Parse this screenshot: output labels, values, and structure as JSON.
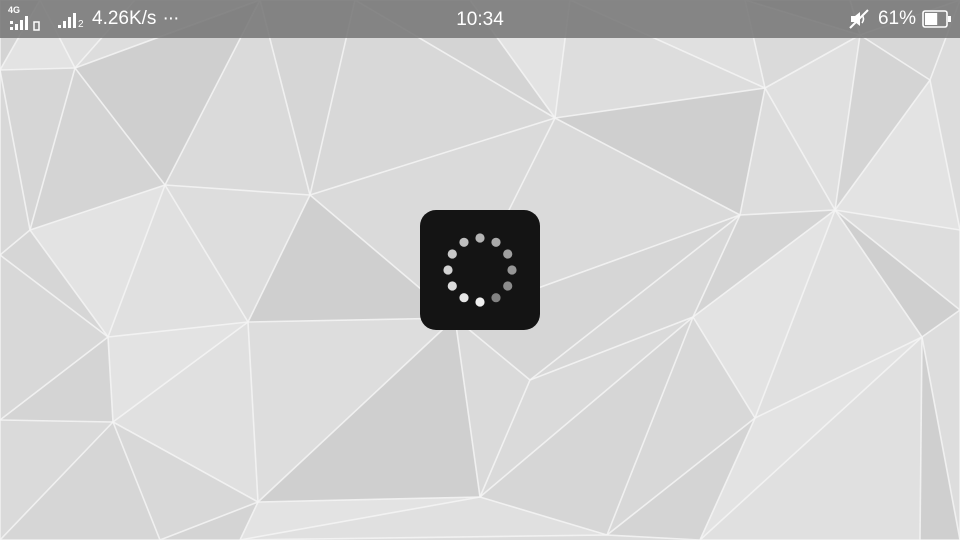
{
  "status_bar": {
    "network_type": "4G",
    "sim2_number": "2",
    "net_speed": "4.26K/s",
    "more_indicator": "···",
    "time": "10:34",
    "battery_percent": "61%",
    "battery_level": 0.61,
    "mute_icon": "speaker-muted-icon",
    "battery_icon": "battery-icon"
  },
  "loading": {
    "spinner_icon": "loading-spinner-icon",
    "dot_count": 12
  },
  "colors": {
    "status_bar_bg": "#787878",
    "background": "#dcdcdc",
    "spinner_box": "#141414"
  }
}
